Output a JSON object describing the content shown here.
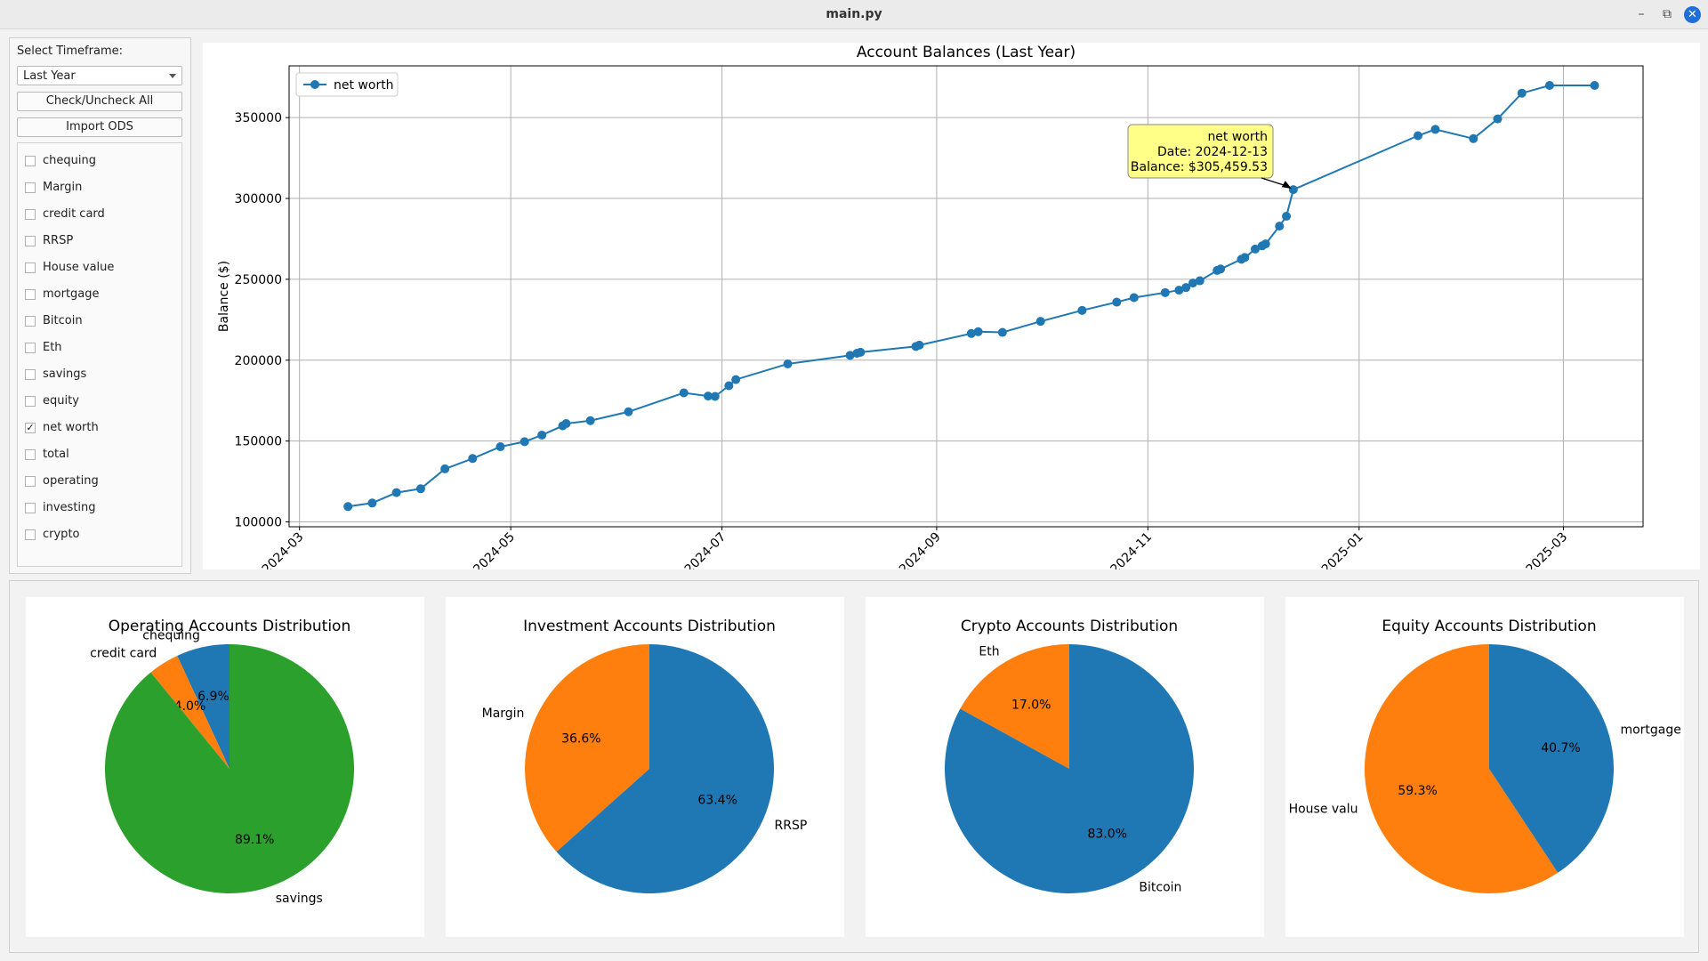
{
  "window": {
    "title": "main.py"
  },
  "sidebar": {
    "timeframe_label": "Select Timeframe:",
    "timeframe_value": "Last Year",
    "check_all_label": "Check/Uncheck All",
    "import_label": "Import ODS",
    "accounts": [
      {
        "label": "chequing",
        "checked": false
      },
      {
        "label": "Margin",
        "checked": false
      },
      {
        "label": "credit card",
        "checked": false
      },
      {
        "label": "RRSP",
        "checked": false
      },
      {
        "label": "House value",
        "checked": false
      },
      {
        "label": "mortgage",
        "checked": false
      },
      {
        "label": "Bitcoin",
        "checked": false
      },
      {
        "label": "Eth",
        "checked": false
      },
      {
        "label": "savings",
        "checked": false
      },
      {
        "label": "equity",
        "checked": false
      },
      {
        "label": "net worth",
        "checked": true
      },
      {
        "label": "total",
        "checked": false
      },
      {
        "label": "operating",
        "checked": false
      },
      {
        "label": "investing",
        "checked": false
      },
      {
        "label": "crypto",
        "checked": false
      }
    ]
  },
  "chart_data": [
    {
      "type": "line",
      "title": "Account Balances (Last Year)",
      "ylabel": "Balance ($)",
      "xlabel": "",
      "x_ticks": [
        "2024-03",
        "2024-05",
        "2024-07",
        "2024-09",
        "2024-11",
        "2025-01",
        "2025-03"
      ],
      "y_ticks": [
        100000,
        150000,
        200000,
        250000,
        300000,
        350000
      ],
      "ylim": [
        97000,
        382000
      ],
      "xlim": [
        "2024-02-27",
        "2025-03-24"
      ],
      "grid": true,
      "legend": "top-left",
      "series": [
        {
          "name": "net worth",
          "color": "#1f77b4",
          "points": [
            [
              "2024-03-15",
              109500
            ],
            [
              "2024-03-22",
              111700
            ],
            [
              "2024-03-29",
              118100
            ],
            [
              "2024-04-05",
              120500
            ],
            [
              "2024-04-12",
              132800
            ],
            [
              "2024-04-20",
              139200
            ],
            [
              "2024-04-28",
              146500
            ],
            [
              "2024-05-05",
              149600
            ],
            [
              "2024-05-10",
              153700
            ],
            [
              "2024-05-16",
              159400
            ],
            [
              "2024-05-17",
              160800
            ],
            [
              "2024-05-24",
              162600
            ],
            [
              "2024-06-04",
              168100
            ],
            [
              "2024-06-20",
              179800
            ],
            [
              "2024-06-27",
              177800
            ],
            [
              "2024-06-29",
              177600
            ],
            [
              "2024-07-03",
              184200
            ],
            [
              "2024-07-05",
              188000
            ],
            [
              "2024-07-20",
              197700
            ],
            [
              "2024-08-07",
              203000
            ],
            [
              "2024-08-09",
              204300
            ],
            [
              "2024-08-10",
              204900
            ],
            [
              "2024-08-26",
              208500
            ],
            [
              "2024-08-27",
              209300
            ],
            [
              "2024-09-11",
              216500
            ],
            [
              "2024-09-13",
              217600
            ],
            [
              "2024-09-20",
              217200
            ],
            [
              "2024-10-01",
              224000
            ],
            [
              "2024-10-13",
              230800
            ],
            [
              "2024-10-23",
              235900
            ],
            [
              "2024-10-28",
              238700
            ],
            [
              "2024-11-06",
              241800
            ],
            [
              "2024-11-10",
              243300
            ],
            [
              "2024-11-12",
              244900
            ],
            [
              "2024-11-14",
              247700
            ],
            [
              "2024-11-16",
              249100
            ],
            [
              "2024-11-21",
              255500
            ],
            [
              "2024-11-22",
              256400
            ],
            [
              "2024-11-28",
              262400
            ],
            [
              "2024-11-29",
              263500
            ],
            [
              "2024-12-02",
              268700
            ],
            [
              "2024-12-04",
              270700
            ],
            [
              "2024-12-05",
              271900
            ],
            [
              "2024-12-09",
              282900
            ],
            [
              "2024-12-11",
              289000
            ],
            [
              "2024-12-13",
              305459.53
            ],
            [
              "2025-01-18",
              338800
            ],
            [
              "2025-01-23",
              342700
            ],
            [
              "2025-02-03",
              337000
            ],
            [
              "2025-02-10",
              349200
            ],
            [
              "2025-02-17",
              365100
            ],
            [
              "2025-02-25",
              369900
            ],
            [
              "2025-03-10",
              369900
            ]
          ]
        }
      ],
      "annotation": {
        "series": "net worth",
        "date_text": "Date: 2024-12-13",
        "balance_text": "Balance: $305,459.53",
        "point": [
          "2024-12-13",
          305459.53
        ]
      }
    },
    {
      "type": "pie",
      "title": "Operating Accounts Distribution",
      "slices": [
        {
          "label": "chequing",
          "pct": 6.9,
          "color": "#1f77b4",
          "pct_label": "6.9%"
        },
        {
          "label": "credit card",
          "pct": 4.0,
          "color": "#ff7f0e",
          "pct_label": "4.0%"
        },
        {
          "label": "savings",
          "pct": 89.1,
          "color": "#2ca02c",
          "pct_label": "89.1%"
        }
      ]
    },
    {
      "type": "pie",
      "title": "Investment Accounts Distribution",
      "slices": [
        {
          "label": "Margin",
          "pct": 36.6,
          "color": "#ff7f0e",
          "pct_label": "36.6%"
        },
        {
          "label": "RRSP",
          "pct": 63.4,
          "color": "#1f77b4",
          "pct_label": "63.4%"
        }
      ]
    },
    {
      "type": "pie",
      "title": "Crypto Accounts Distribution",
      "slices": [
        {
          "label": "Eth",
          "pct": 17.0,
          "color": "#ff7f0e",
          "pct_label": "17.0%"
        },
        {
          "label": "Bitcoin",
          "pct": 83.0,
          "color": "#1f77b4",
          "pct_label": "83.0%"
        }
      ]
    },
    {
      "type": "pie",
      "title": "Equity Accounts Distribution",
      "slices": [
        {
          "label": "House valu",
          "pct": 59.3,
          "color": "#ff7f0e",
          "pct_label": "59.3%"
        },
        {
          "label": "mortgage",
          "pct": 40.7,
          "color": "#1f77b4",
          "pct_label": "40.7%"
        }
      ]
    }
  ]
}
